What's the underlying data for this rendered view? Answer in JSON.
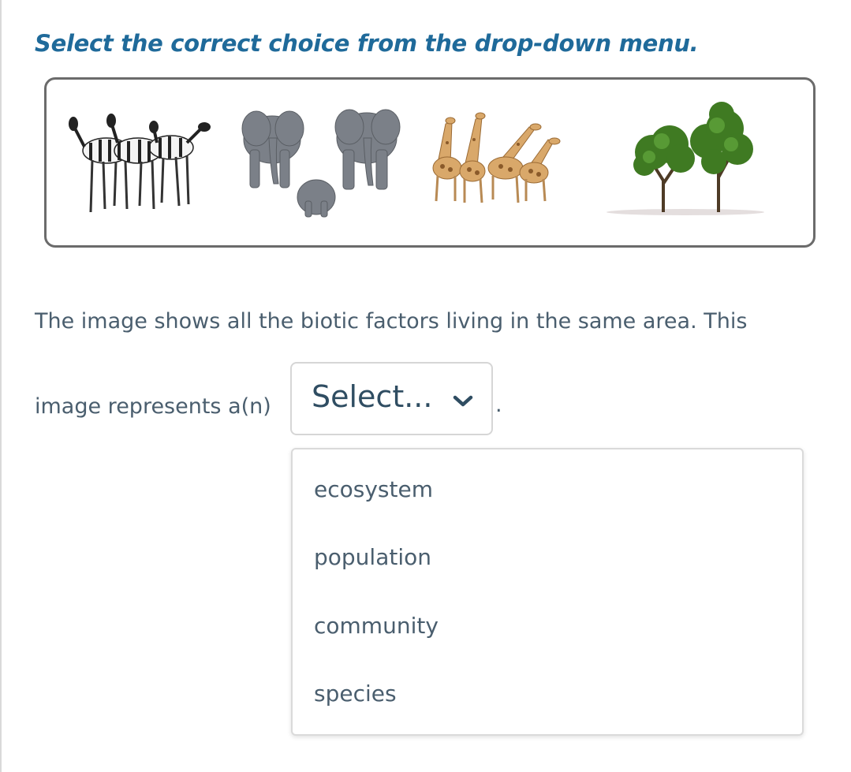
{
  "question": {
    "instruction": "Select the correct choice from the drop-down menu.",
    "sentence_line1": "The image shows all the biotic factors living in the same area. This",
    "sentence_line2": "image represents a(n)",
    "sentence_end": "."
  },
  "image_panel": {
    "items": [
      "zebras",
      "elephants",
      "giraffes",
      "trees"
    ]
  },
  "dropdown": {
    "selected_label": "Select...",
    "options": [
      "ecosystem",
      "population",
      "community",
      "species"
    ],
    "expanded": true
  },
  "colors": {
    "instruction_blue": "#1f6a9a",
    "body_text": "#4a5e6e",
    "select_text": "#2f4d62"
  }
}
